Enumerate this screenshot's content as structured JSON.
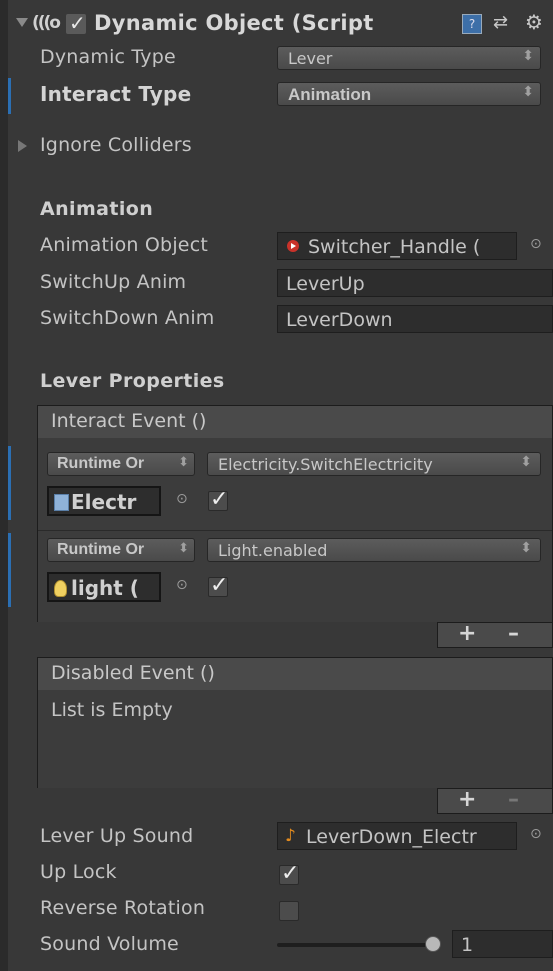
{
  "component": {
    "title": "Dynamic Object (Script",
    "enabled": true,
    "script_icon": "(((o",
    "help_icon": "?",
    "preset_icon": "⇄",
    "gear_icon": "⚙"
  },
  "fields": {
    "dynamic_type_label": "Dynamic Type",
    "dynamic_type_value": "Lever",
    "interact_type_label": "Interact Type",
    "interact_type_value": "Animation",
    "ignore_colliders_label": "Ignore Colliders"
  },
  "animation": {
    "header": "Animation",
    "object_label": "Animation Object",
    "object_value": "Switcher_Handle (",
    "switch_up_label": "SwitchUp Anim",
    "switch_up_value": "LeverUp",
    "switch_down_label": "SwitchDown Anim",
    "switch_down_value": "LeverDown"
  },
  "lever": {
    "header": "Lever Properties",
    "interact_event": {
      "title": "Interact Event ()",
      "entries": [
        {
          "mode": "Runtime Or",
          "function": "Electricity.SwitchElectricity",
          "target": "Electr",
          "checked": true
        },
        {
          "mode": "Runtime Or",
          "function": "Light.enabled",
          "target": "light (",
          "checked": true
        }
      ],
      "add": "+",
      "remove": "–"
    },
    "disabled_event": {
      "title": "Disabled Event ()",
      "empty_text": "List is Empty",
      "add": "+",
      "remove": "–"
    },
    "up_sound_label": "Lever Up Sound",
    "up_sound_value": "LeverDown_Electr",
    "up_lock_label": "Up Lock",
    "up_lock_checked": true,
    "reverse_rotation_label": "Reverse Rotation",
    "reverse_rotation_checked": false,
    "sound_volume_label": "Sound Volume",
    "sound_volume_value": "1",
    "sound_volume_fraction": 1.0
  },
  "colors": {
    "background": "#383838",
    "accent_blue": "#2b6fb3",
    "field_bg": "#2d2d2d"
  }
}
